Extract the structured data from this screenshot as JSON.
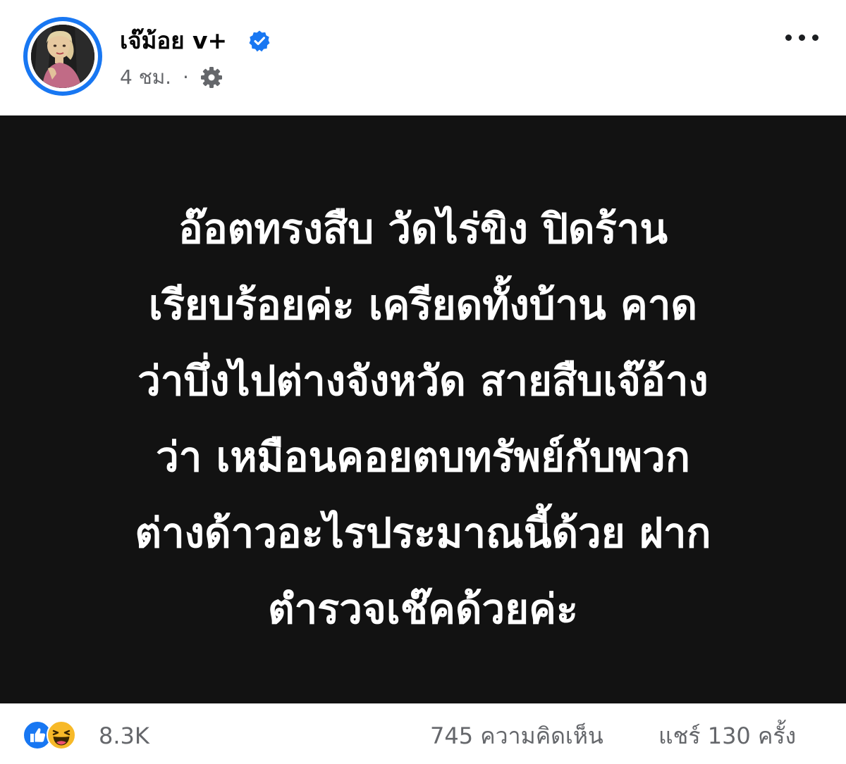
{
  "post": {
    "page_name": "เจ๊ม้อย v+",
    "timestamp": "4 ชม.",
    "separator": "·",
    "verified_icon": "verified-badge-icon",
    "audience_icon": "gear-icon",
    "more_icon": "more-options-icon",
    "accent_color": "#1877f2"
  },
  "media": {
    "background_color": "#121212",
    "text_color": "#ffffff",
    "lines": [
      "อ๊อตทรงสืบ วัดไร่ขิง ปิดร้าน",
      "เรียบร้อยค่ะ เครียดทั้งบ้าน คาด",
      "ว่าบึ่งไปต่างจังหวัด สายสืบเจ๊อ้าง",
      "ว่า เหมือนคอยตบทรัพย์กับพวก",
      "ต่างด้าวอะไรประมาณนี้ด้วย ฝาก",
      "ตำรวจเช๊คด้วยค่ะ"
    ]
  },
  "stats": {
    "reactions": [
      "like-icon",
      "haha-icon"
    ],
    "reaction_count": "8.3K",
    "comments": "745 ความคิดเห็น",
    "shares": "แชร์ 130 ครั้ง"
  }
}
